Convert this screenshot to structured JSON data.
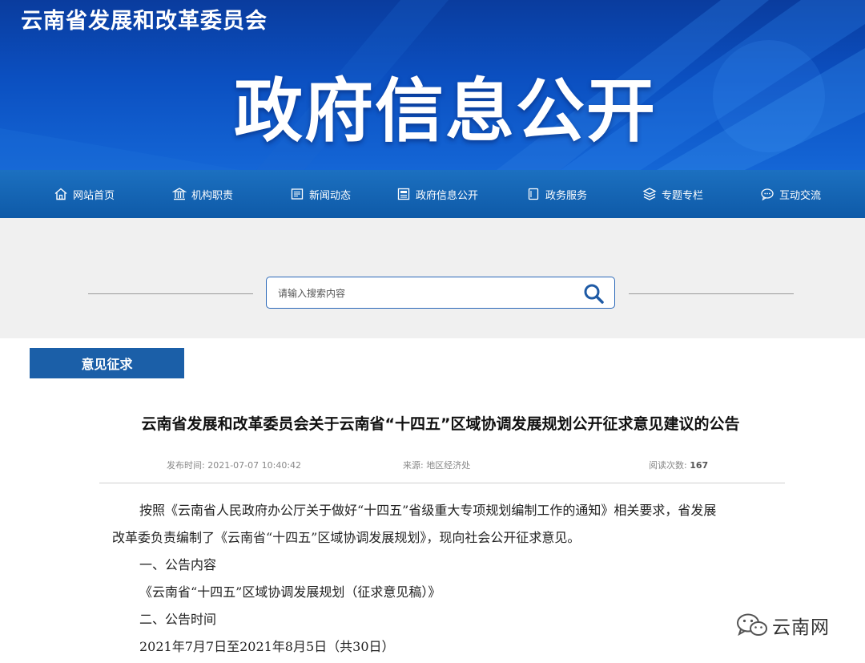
{
  "header": {
    "site_name": "云南省发展和改革委员会",
    "banner_title": "政府信息公开"
  },
  "nav": {
    "items": [
      {
        "label": "网站首页",
        "icon": "home-icon"
      },
      {
        "label": "机构职责",
        "icon": "institution-icon"
      },
      {
        "label": "新闻动态",
        "icon": "newspaper-icon"
      },
      {
        "label": "政府信息公开",
        "icon": "document-icon"
      },
      {
        "label": "政务服务",
        "icon": "service-icon"
      },
      {
        "label": "专题专栏",
        "icon": "layers-icon"
      },
      {
        "label": "互动交流",
        "icon": "chat-icon"
      }
    ]
  },
  "search": {
    "placeholder": "请输入搜索内容",
    "button_icon": "search-icon"
  },
  "section": {
    "category": "意见征求"
  },
  "article": {
    "title": "云南省发展和改革委员会关于云南省“十四五”区域协调发展规划公开征求意见建议的公告",
    "meta": {
      "published_label": "发布时间:",
      "published_value": "2021-07-07 10:40:42",
      "source_label": "来源:",
      "source_value": "地区经济处",
      "views_label": "阅读次数:",
      "views_value": "167"
    },
    "paragraphs": {
      "p1_line1": "按照《云南省人民政府办公厅关于做好“十四五”省级重大专项规划编制工作的通知》相关要求，省发展",
      "p1_line2": "改革委负责编制了《云南省“十四五”区域协调发展规划》，现向社会公开征求意见。",
      "h1": "一、公告内容",
      "p2": "《云南省“十四五”区域协调发展规划（征求意见稿）》",
      "h2": "二、公告时间",
      "p3": "2021年7月7日至2021年8月5日（共30日）"
    }
  },
  "watermark": {
    "text": "云南网",
    "icon": "wechat-icon"
  }
}
